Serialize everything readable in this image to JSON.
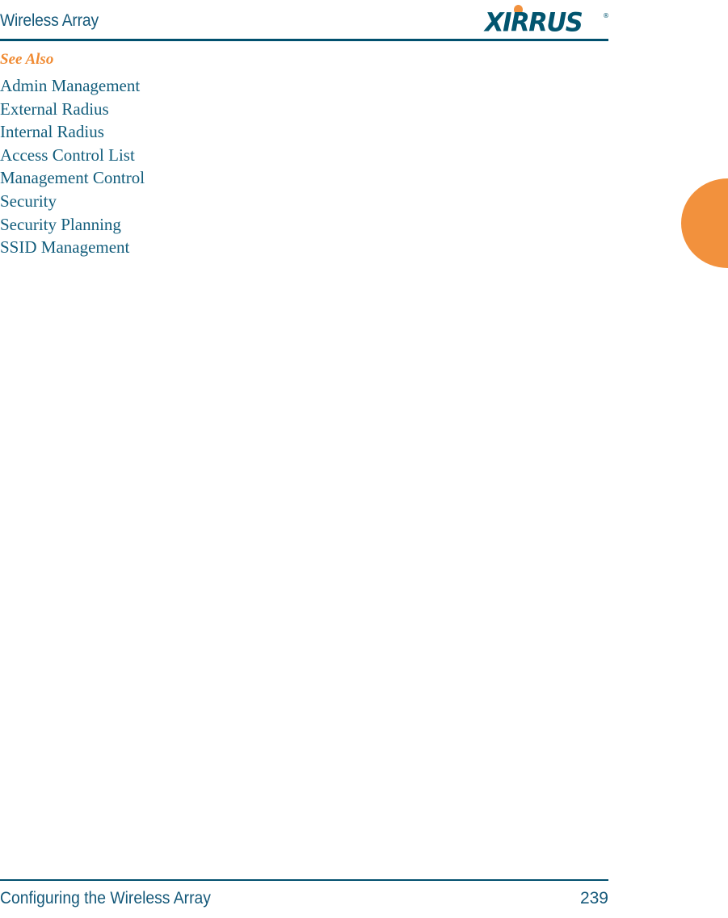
{
  "header": {
    "title": "Wireless Array",
    "logo": {
      "wordmark": "XIRRUS",
      "registered_mark": "®",
      "dot_color": "#f2913d",
      "text_color": "#02556f",
      "name": "xirrus-logo"
    },
    "rule_color": "#01506e"
  },
  "content": {
    "see_also_heading": "See Also",
    "see_also_color": "#f08b33",
    "links": [
      {
        "label": "Admin Management"
      },
      {
        "label": "External Radius"
      },
      {
        "label": "Internal Radius"
      },
      {
        "label": "Access Control List"
      },
      {
        "label": "Management Control"
      },
      {
        "label": "Security"
      },
      {
        "label": "Security Planning"
      },
      {
        "label": "SSID Management"
      }
    ],
    "link_color": "#125d7c"
  },
  "edge_tab": {
    "color": "#f2913d",
    "name": "section-thumb-tab"
  },
  "footer": {
    "left_text": "Configuring the Wireless Array",
    "page_number": "239",
    "rule_color": "#01506e",
    "text_color": "#15597a"
  }
}
